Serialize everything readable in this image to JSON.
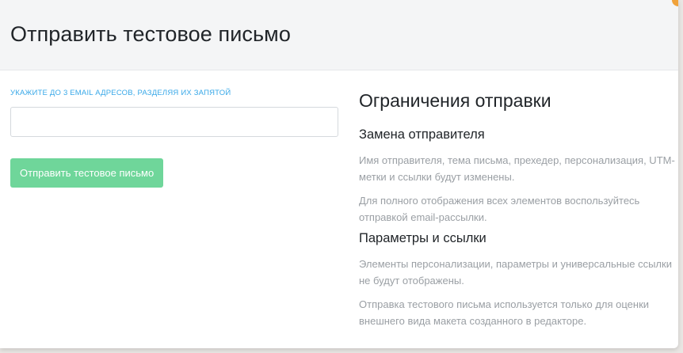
{
  "modal": {
    "title": "Отправить тестовое письмо"
  },
  "form": {
    "email_label": "УКАЖИТЕ ДО 3 EMAIL АДРЕСОВ, РАЗДЕЛЯЯ ИХ ЗАПЯТОЙ",
    "email_value": "",
    "email_placeholder": "",
    "send_button_label": "Отправить тестовое письмо"
  },
  "limits": {
    "title": "Ограничения отправки",
    "sections": [
      {
        "heading": "Замена отправителя",
        "paragraphs": [
          "Имя отправителя, тема письма, прехедер, персонализация, UTM-метки и ссылки будут изменены.",
          "Для полного отображения всех элементов воспользуйтесь отправкой email-рассылки."
        ]
      },
      {
        "heading": "Параметры и ссылки",
        "paragraphs": [
          "Элементы персонализации, параметры и универсальные ссылки не будут отображены.",
          "Отправка тестового письма используется только для оценки внешнего вида макета созданного в редакторе."
        ]
      }
    ]
  },
  "colors": {
    "accent_label": "#38a8e8",
    "button_bg": "#6fd69a",
    "header_bg": "#f4f5f6",
    "muted_text": "#9a9fa4"
  }
}
